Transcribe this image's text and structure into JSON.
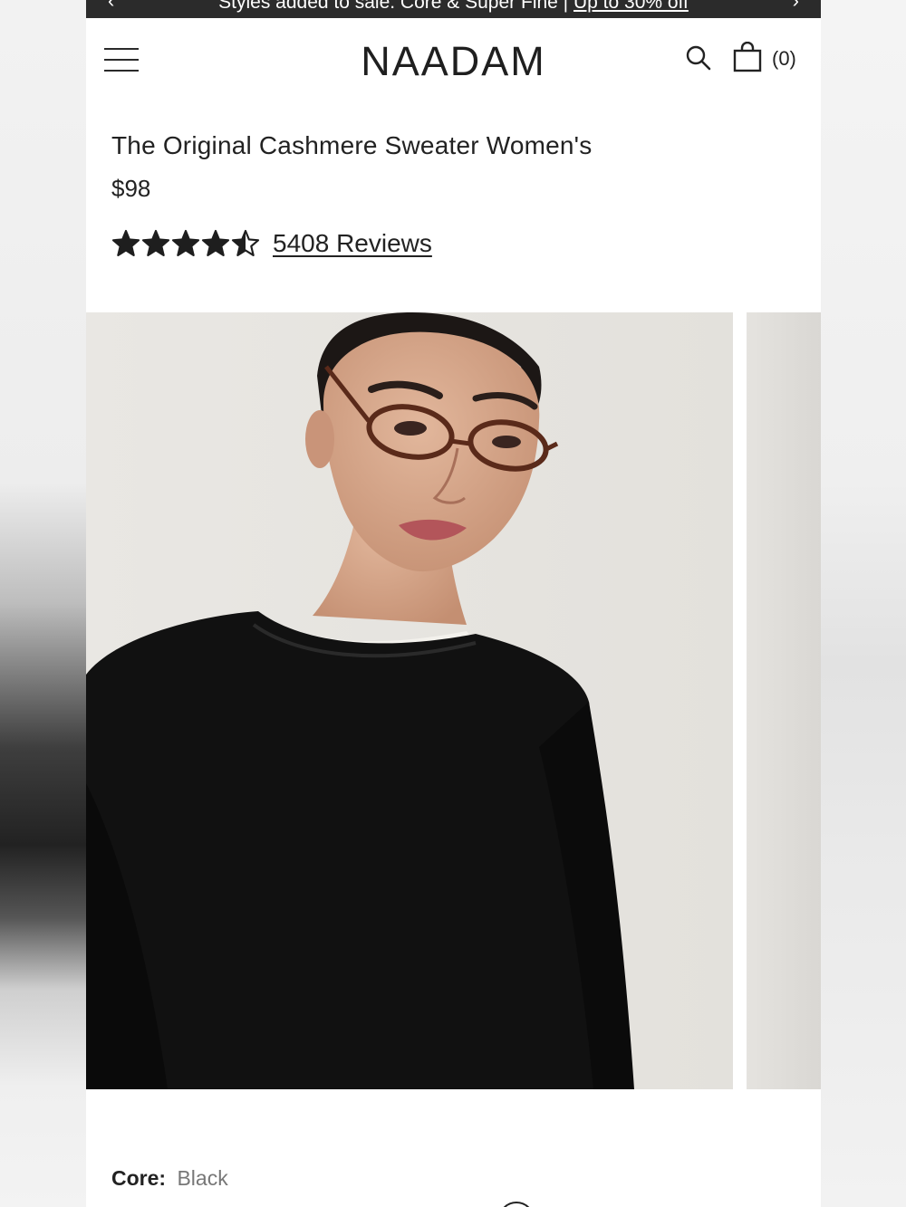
{
  "promo": {
    "text": "Styles added to sale. Core & Super Fine | ",
    "link": "Up to 30% off",
    "prev_arrow": "‹",
    "next_arrow": "›"
  },
  "header": {
    "brand": "NAADAM",
    "cart_count": "(0)",
    "icons": [
      "menu-icon",
      "search-icon",
      "shopping-bag-icon"
    ]
  },
  "product": {
    "title": "The Original Cashmere Sweater Women's",
    "price": "$98",
    "rating": 4.5,
    "rating_max": 5,
    "reviews_label": "5408 Reviews"
  },
  "variant": {
    "label": "Core:",
    "value": "Black"
  },
  "colors": {
    "promo_bg": "#2b2b2b",
    "text": "#222222",
    "sweater": "#111111"
  }
}
